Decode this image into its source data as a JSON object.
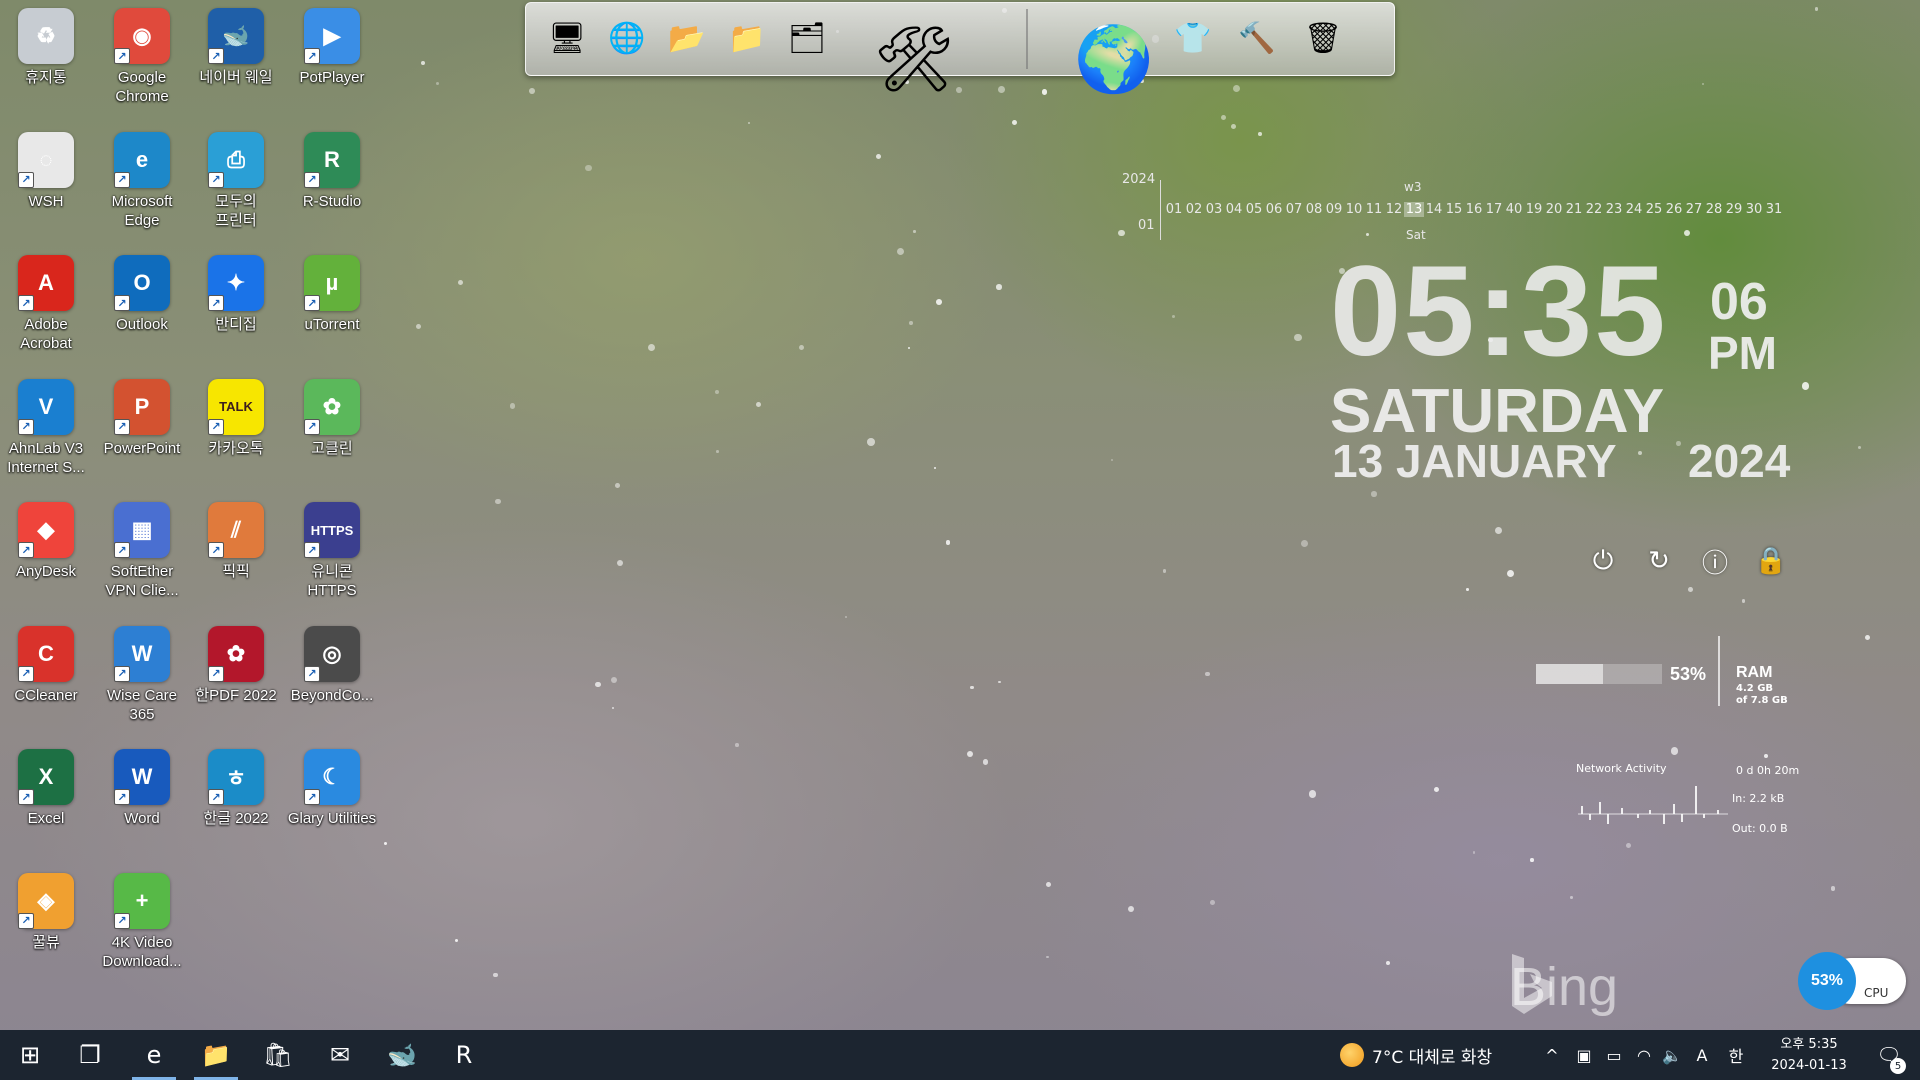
{
  "desktop": {
    "icons": [
      {
        "label": "휴지통",
        "icon": "recycle-bin-icon",
        "color": "#c7ccd2",
        "glyph": "♻"
      },
      {
        "label": "Google\nChrome",
        "icon": "chrome-icon",
        "color": "#e04a3c",
        "glyph": "◉"
      },
      {
        "label": "네이버 웨일",
        "icon": "naver-whale-icon",
        "color": "#1f5fa8",
        "glyph": "🐋"
      },
      {
        "label": "PotPlayer",
        "icon": "potplayer-icon",
        "color": "#3a8ee6",
        "glyph": "▶"
      },
      {
        "label": "WSH",
        "icon": "wsh-icon",
        "color": "#e8e8e8",
        "glyph": "◌"
      },
      {
        "label": "Microsoft\nEdge",
        "icon": "edge-icon",
        "color": "#1d88c9",
        "glyph": "e"
      },
      {
        "label": "모두의\n프린터",
        "icon": "printer-icon",
        "color": "#2a9fd6",
        "glyph": "⎙"
      },
      {
        "label": "R-Studio",
        "icon": "r-studio-icon",
        "color": "#2e8b57",
        "glyph": "R"
      },
      {
        "label": "Adobe\nAcrobat",
        "icon": "acrobat-icon",
        "color": "#d9261c",
        "glyph": "A"
      },
      {
        "label": "Outlook",
        "icon": "outlook-icon",
        "color": "#0f6cbd",
        "glyph": "O"
      },
      {
        "label": "반디집",
        "icon": "bandizip-icon",
        "color": "#1a73e8",
        "glyph": "✦"
      },
      {
        "label": "uTorrent",
        "icon": "utorrent-icon",
        "color": "#63b13b",
        "glyph": "µ"
      },
      {
        "label": "AhnLab V3\nInternet S...",
        "icon": "v3-icon",
        "color": "#1a7fd0",
        "glyph": "V"
      },
      {
        "label": "PowerPoint",
        "icon": "powerpoint-icon",
        "color": "#d35230",
        "glyph": "P"
      },
      {
        "label": "카카오톡",
        "icon": "kakaotalk-icon",
        "color": "#f7e600",
        "glyph": "TALK"
      },
      {
        "label": "고클린",
        "icon": "goclean-icon",
        "color": "#5bb85b",
        "glyph": "✿"
      },
      {
        "label": "AnyDesk",
        "icon": "anydesk-icon",
        "color": "#ef443b",
        "glyph": "◆"
      },
      {
        "label": "SoftEther\nVPN Clie...",
        "icon": "softether-icon",
        "color": "#4a6fd1",
        "glyph": "▦"
      },
      {
        "label": "픽픽",
        "icon": "picpick-icon",
        "color": "#e07a3c",
        "glyph": "⫽"
      },
      {
        "label": "유니콘\nHTTPS",
        "icon": "unicorn-https-icon",
        "color": "#3b3f8f",
        "glyph": "HTTPS"
      },
      {
        "label": "CCleaner",
        "icon": "ccleaner-icon",
        "color": "#d9322b",
        "glyph": "C"
      },
      {
        "label": "Wise Care\n365",
        "icon": "wise-care-icon",
        "color": "#2d7fd3",
        "glyph": "W"
      },
      {
        "label": "한PDF 2022",
        "icon": "hanpdf-icon",
        "color": "#b3172b",
        "glyph": "✿"
      },
      {
        "label": "BeyondCo...",
        "icon": "beyond-compare-icon",
        "color": "#4b4b4b",
        "glyph": "◎"
      },
      {
        "label": "Excel",
        "icon": "excel-icon",
        "color": "#1d7044",
        "glyph": "X"
      },
      {
        "label": "Word",
        "icon": "word-icon",
        "color": "#185abd",
        "glyph": "W"
      },
      {
        "label": "한글 2022",
        "icon": "hangul-icon",
        "color": "#1b8cc8",
        "glyph": "ㅎ"
      },
      {
        "label": "Glary Utilities",
        "icon": "glary-icon",
        "color": "#2a8ae0",
        "glyph": "☾"
      },
      {
        "label": "꿀뷰",
        "icon": "honeyview-icon",
        "color": "#f0a030",
        "glyph": "◈"
      },
      {
        "label": "4K Video\nDownload...",
        "icon": "4k-video-downloader-icon",
        "color": "#57b947",
        "glyph": "+"
      }
    ]
  },
  "dock": {
    "items": [
      {
        "icon": "computer-icon",
        "glyph": "🖥"
      },
      {
        "icon": "network-globe-icon",
        "glyph": "🌐"
      },
      {
        "icon": "folder-icon",
        "glyph": "📂"
      },
      {
        "icon": "folder-green-icon",
        "glyph": "📁"
      },
      {
        "icon": "folder-open-icon",
        "glyph": "🗂"
      },
      {
        "icon": "tools-icon",
        "glyph": "🛠"
      },
      {
        "icon": "globe-icon",
        "glyph": "🌍"
      },
      {
        "icon": "tshirt-icon",
        "glyph": "👕"
      },
      {
        "icon": "hammer-icon",
        "glyph": "🔨"
      },
      {
        "icon": "recycle-bin-icon",
        "glyph": "🗑"
      }
    ]
  },
  "calendar": {
    "year": "2024",
    "week": "w3",
    "month": "01",
    "day_of_week": "Sat",
    "today": "13",
    "days": [
      "01",
      "02",
      "03",
      "04",
      "05",
      "06",
      "07",
      "08",
      "09",
      "10",
      "11",
      "12",
      "13",
      "14",
      "15",
      "16",
      "17",
      "40",
      "19",
      "20",
      "21",
      "22",
      "23",
      "24",
      "25",
      "26",
      "27",
      "28",
      "29",
      "30",
      "31"
    ]
  },
  "clock": {
    "time": "05:35",
    "seconds": "06",
    "ampm": "PM",
    "day": "SATURDAY",
    "date": "13 JANUARY",
    "year": "2024"
  },
  "power_buttons": [
    {
      "icon": "power-icon",
      "glyph": "⏻"
    },
    {
      "icon": "restart-icon",
      "glyph": "↻"
    },
    {
      "icon": "info-icon",
      "glyph": "ⓘ"
    },
    {
      "icon": "lock-icon",
      "glyph": "🔒"
    }
  ],
  "ram": {
    "percent_label": "53%",
    "percent": 0.53,
    "label": "RAM",
    "used": "4.2 GB",
    "total": "of 7.8 GB"
  },
  "network": {
    "title": "Network Activity",
    "uptime": "0 d 0h 20m",
    "in": "In: 2.2 kB",
    "out": "Out: 0.0 B"
  },
  "watermark": {
    "brand": "Bing"
  },
  "cpu": {
    "percent_label": "53%",
    "label": "CPU"
  },
  "taskbar": {
    "apps": [
      {
        "icon": "windows-start-icon",
        "glyph": "⊞",
        "active": false
      },
      {
        "icon": "task-view-icon",
        "glyph": "❐",
        "active": false
      },
      {
        "icon": "edge-icon",
        "glyph": "e",
        "active": true
      },
      {
        "icon": "file-explorer-icon",
        "glyph": "📁",
        "active": true
      },
      {
        "icon": "store-icon",
        "glyph": "🛍",
        "active": false
      },
      {
        "icon": "mail-icon",
        "glyph": "✉",
        "active": false
      },
      {
        "icon": "whale-icon",
        "glyph": "🐋",
        "active": false
      },
      {
        "icon": "r-app-icon",
        "glyph": "R",
        "active": false
      }
    ],
    "weather": "7°C  대체로 화창",
    "tray": [
      {
        "icon": "chevron-up-icon",
        "glyph": "^"
      },
      {
        "icon": "webcam-icon",
        "glyph": "▣"
      },
      {
        "icon": "battery-icon",
        "glyph": "▭"
      },
      {
        "icon": "wifi-icon",
        "glyph": "◠"
      },
      {
        "icon": "volume-icon",
        "glyph": "🔈"
      },
      {
        "icon": "ime-a-icon",
        "glyph": "A"
      },
      {
        "icon": "ime-han-icon",
        "glyph": "한"
      }
    ],
    "clock_time": "오후 5:35",
    "clock_date": "2024-01-13",
    "notification_count": "5"
  }
}
